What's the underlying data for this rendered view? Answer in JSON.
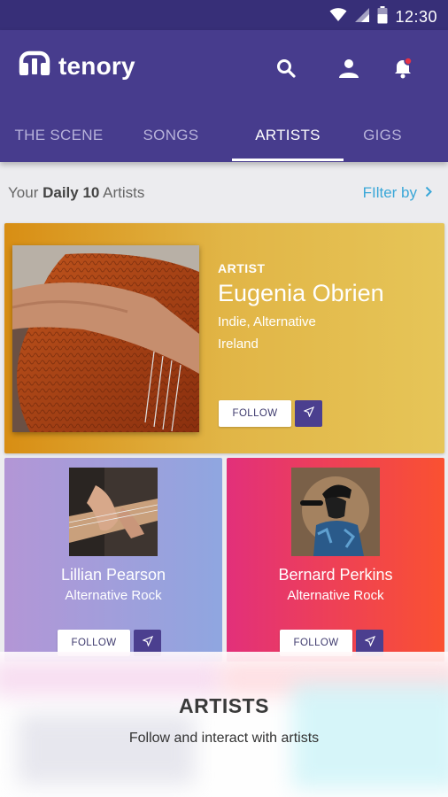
{
  "status_bar": {
    "time": "12:30",
    "icons": [
      "wifi-icon",
      "signal-icon",
      "battery-icon"
    ]
  },
  "app": {
    "name": "tenory",
    "actions": [
      "search-icon",
      "account-icon",
      "notifications-icon"
    ]
  },
  "tabs": [
    {
      "label": "THE SCENE",
      "active": false
    },
    {
      "label": "SONGS",
      "active": false
    },
    {
      "label": "ARTISTS",
      "active": true
    },
    {
      "label": "GIGS",
      "active": false
    }
  ],
  "filter_bar": {
    "prefix": "Your",
    "highlight": "Daily 10",
    "suffix": "Artists",
    "filter_label": "FIlter by"
  },
  "featured": {
    "label": "ARTIST",
    "name": "Eugenia Obrien",
    "genre": "Indie, Alternative",
    "location": "Ireland",
    "follow_label": "FOLLOW"
  },
  "cards": [
    {
      "name": "Lillian Pearson",
      "genre": "Alternative Rock",
      "follow_label": "FOLLOW"
    },
    {
      "name": "Bernard Perkins",
      "genre": "Alternative Rock",
      "follow_label": "FOLLOW"
    }
  ],
  "overlay": {
    "title": "ARTISTS",
    "subtitle": "Follow and interact with artists"
  },
  "colors": {
    "app_bar": "#473c8d",
    "status_bar": "#372f78",
    "link": "#3aa7d8",
    "featured_gradient": [
      "#d88e14",
      "#e6c558"
    ],
    "card1_gradient": [
      "#b396d6",
      "#8fa6e0"
    ],
    "card2_gradient": [
      "#e2307a",
      "#fa5131"
    ]
  }
}
